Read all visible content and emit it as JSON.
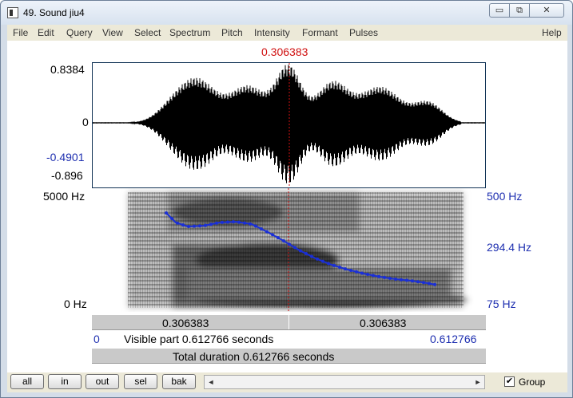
{
  "window": {
    "title": "49. Sound jiu4",
    "controls": {
      "minimize": "▭",
      "maximize": "⧉",
      "close": "✕"
    }
  },
  "menu": {
    "items": [
      "File",
      "Edit",
      "Query",
      "View",
      "Select",
      "Spectrum",
      "Pitch",
      "Intensity",
      "Formant",
      "Pulses"
    ],
    "help": "Help"
  },
  "cursor": {
    "time_label": "0.306383",
    "color": "#d01010"
  },
  "waveform": {
    "y_max_label": "0.8384",
    "y_zero_label": "0",
    "cursor_value_label": "-0.4901",
    "y_min_label": "-0.896"
  },
  "spectrogram": {
    "freq_top_label": "5000 Hz",
    "freq_bottom_label": "0 Hz",
    "pitch_top_label": "500 Hz",
    "pitch_mid_label": "294.4 Hz",
    "pitch_bottom_label": "75 Hz",
    "pitch_color": "#1a2fd6"
  },
  "time_bars": {
    "left_segment": "0.306383",
    "right_segment": "0.306383",
    "start": "0",
    "visible_label": "Visible part 0.612766 seconds",
    "end": "0.612766",
    "total_label": "Total duration 0.612766 seconds"
  },
  "controls": {
    "buttons": [
      "all",
      "in",
      "out",
      "sel",
      "bak"
    ],
    "group_label": "Group",
    "group_checked": true,
    "scroll_left": "◄",
    "scroll_right": "►"
  }
}
